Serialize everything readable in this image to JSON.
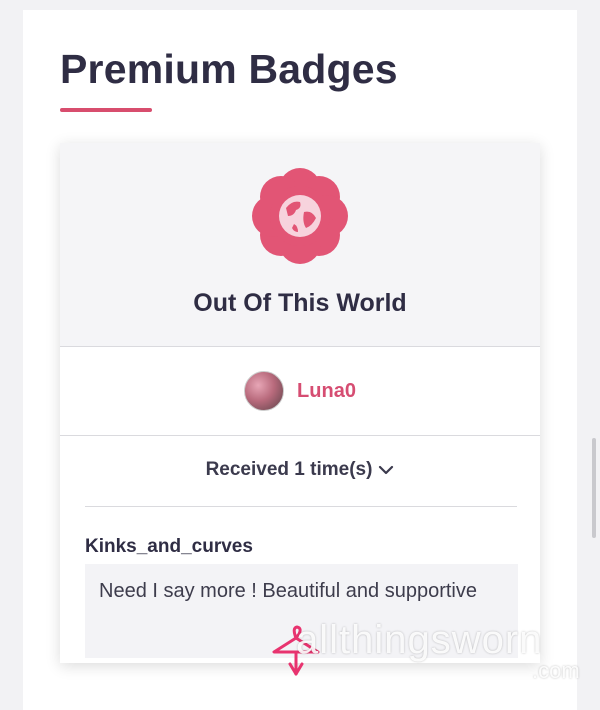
{
  "section": {
    "title": "Premium Badges"
  },
  "badge": {
    "icon": "globe-flower-icon",
    "name": "Out Of This World",
    "accent_color": "#e25575"
  },
  "owner": {
    "name": "Luna0",
    "name_color": "#d64d72"
  },
  "received": {
    "label": "Received 1 time(s)",
    "icon": "chevron-down-icon"
  },
  "entry": {
    "giver": "Kinks_and_curves",
    "message": "Need I say more ! Beautiful and supportive"
  },
  "watermark": {
    "text": "allthingsworn",
    "suffix": ".com"
  }
}
